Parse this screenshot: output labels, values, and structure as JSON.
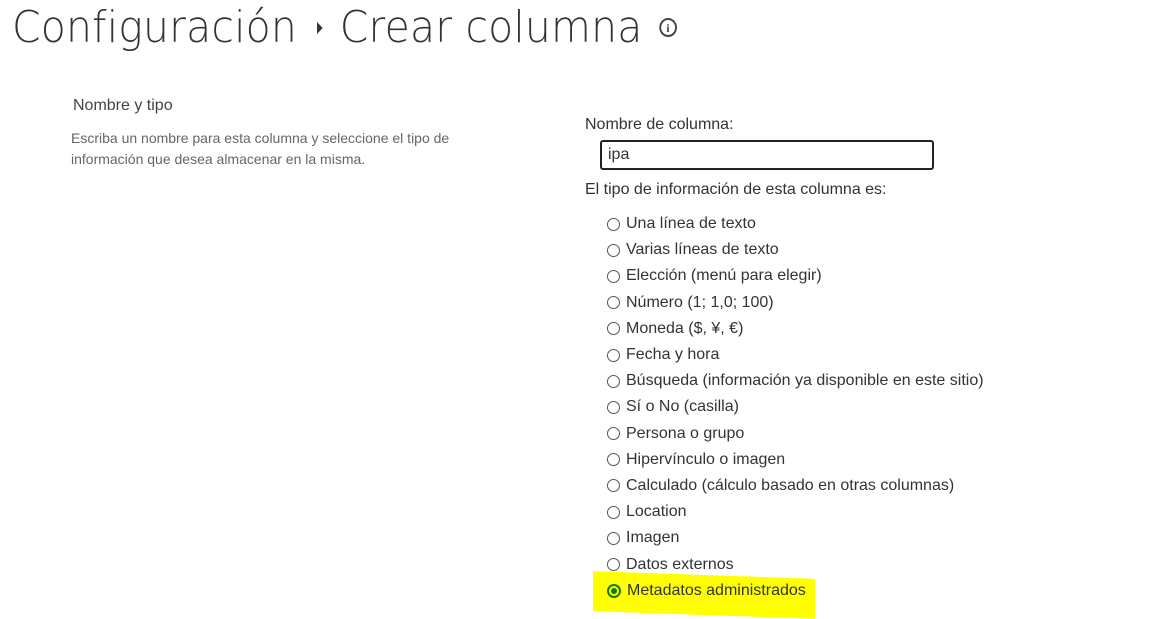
{
  "header": {
    "breadcrumb_parent": "Configuración",
    "title": "Crear columna",
    "info_icon": "info-icon"
  },
  "section": {
    "title": "Nombre y tipo",
    "description": "Escriba un nombre para esta columna y seleccione el tipo de información que desea almacenar en la misma."
  },
  "form": {
    "column_name_label": "Nombre de columna:",
    "column_name_value": "ipa",
    "type_label": "El tipo de información de esta columna es:",
    "types": [
      {
        "label": "Una línea de texto",
        "selected": false
      },
      {
        "label": "Varias líneas de texto",
        "selected": false
      },
      {
        "label": "Elección (menú para elegir)",
        "selected": false
      },
      {
        "label": "Número (1; 1,0; 100)",
        "selected": false
      },
      {
        "label": "Moneda ($, ¥, €)",
        "selected": false
      },
      {
        "label": "Fecha y hora",
        "selected": false
      },
      {
        "label": "Búsqueda (información ya disponible en este sitio)",
        "selected": false
      },
      {
        "label": "Sí o No (casilla)",
        "selected": false
      },
      {
        "label": "Persona o grupo",
        "selected": false
      },
      {
        "label": "Hipervínculo o imagen",
        "selected": false
      },
      {
        "label": "Calculado (cálculo basado en otras columnas)",
        "selected": false
      },
      {
        "label": "Location",
        "selected": false
      },
      {
        "label": "Imagen",
        "selected": false
      },
      {
        "label": "Datos externos",
        "selected": false
      },
      {
        "label": "Metadatos administrados",
        "selected": true
      }
    ]
  },
  "colors": {
    "selected_radio": "#107c10",
    "highlight": "#ffff00"
  }
}
